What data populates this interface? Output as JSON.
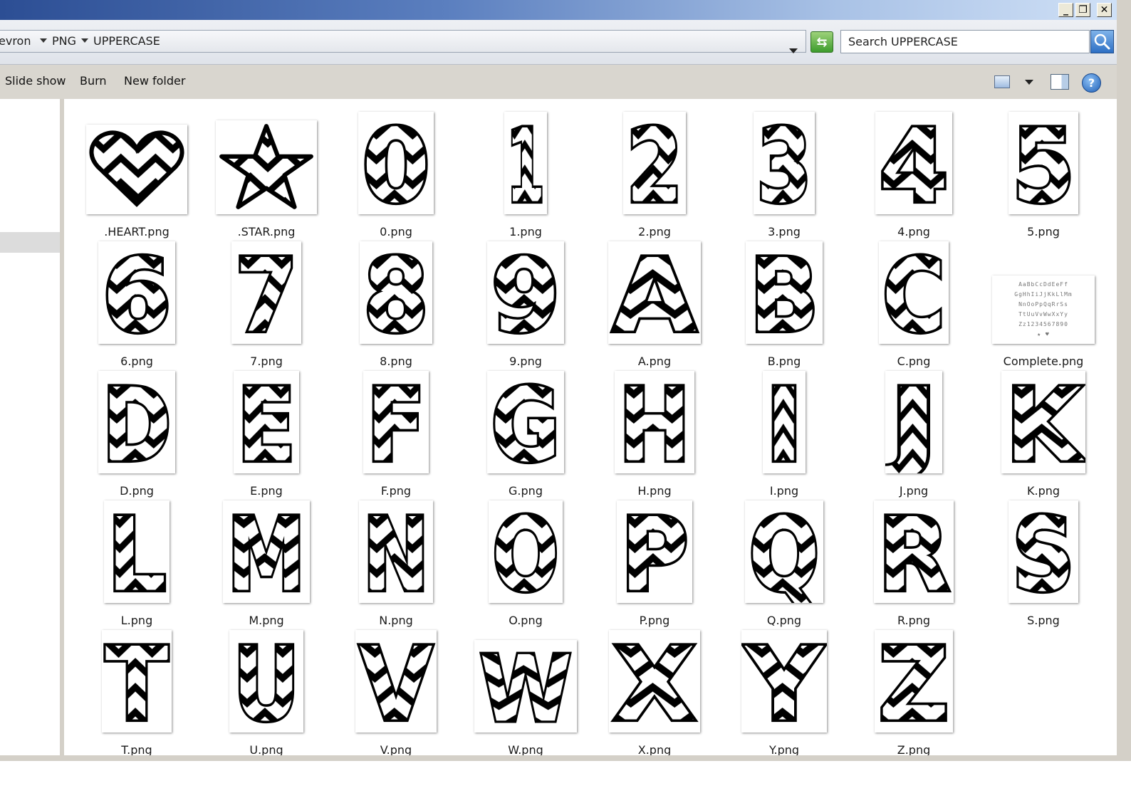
{
  "titlebar": {
    "minimize": "_",
    "restore": "❐",
    "close": "✕"
  },
  "address": {
    "crumbs": [
      "evron",
      "PNG",
      "UPPERCASE"
    ],
    "search_value": "Search UPPERCASE"
  },
  "toolbar": {
    "slideshow_label": "Slide show",
    "burn_label": "Burn",
    "new_folder_label": "New folder",
    "help_label": "?"
  },
  "files": [
    {
      "name": ".HEART.png",
      "shape": "heart"
    },
    {
      "name": ".STAR.png",
      "shape": "star"
    },
    {
      "name": "0.png",
      "glyph": "0"
    },
    {
      "name": "1.png",
      "glyph": "1"
    },
    {
      "name": "2.png",
      "glyph": "2"
    },
    {
      "name": "3.png",
      "glyph": "3"
    },
    {
      "name": "4.png",
      "glyph": "4"
    },
    {
      "name": "5.png",
      "glyph": "5"
    },
    {
      "name": "6.png",
      "glyph": "6"
    },
    {
      "name": "7.png",
      "glyph": "7"
    },
    {
      "name": "8.png",
      "glyph": "8"
    },
    {
      "name": "9.png",
      "glyph": "9"
    },
    {
      "name": "A.png",
      "glyph": "A"
    },
    {
      "name": "B.png",
      "glyph": "B"
    },
    {
      "name": "C.png",
      "glyph": "C"
    },
    {
      "name": "Complete.png",
      "shape": "complete"
    },
    {
      "name": "D.png",
      "glyph": "D"
    },
    {
      "name": "E.png",
      "glyph": "E"
    },
    {
      "name": "F.png",
      "glyph": "F"
    },
    {
      "name": "G.png",
      "glyph": "G"
    },
    {
      "name": "H.png",
      "glyph": "H"
    },
    {
      "name": "I.png",
      "glyph": "I"
    },
    {
      "name": "J.png",
      "glyph": "J"
    },
    {
      "name": "K.png",
      "glyph": "K"
    },
    {
      "name": "L.png",
      "glyph": "L"
    },
    {
      "name": "M.png",
      "glyph": "M"
    },
    {
      "name": "N.png",
      "glyph": "N"
    },
    {
      "name": "O.png",
      "glyph": "O"
    },
    {
      "name": "P.png",
      "glyph": "P"
    },
    {
      "name": "Q.png",
      "glyph": "Q"
    },
    {
      "name": "R.png",
      "glyph": "R"
    },
    {
      "name": "S.png",
      "glyph": "S"
    },
    {
      "name": "T.png",
      "glyph": "T"
    },
    {
      "name": "U.png",
      "glyph": "U"
    },
    {
      "name": "V.png",
      "glyph": "V"
    },
    {
      "name": "W.png",
      "glyph": "W"
    },
    {
      "name": "X.png",
      "glyph": "X"
    },
    {
      "name": "Y.png",
      "glyph": "Y"
    },
    {
      "name": "Z.png",
      "glyph": "Z"
    }
  ],
  "complete_preview_rows": [
    "AaBbCcDdEeFf",
    "GgHhIiJjKkLlMm",
    "NnOoPpQqRrSs",
    "TtUuVvWwXxYy",
    "Zz1234567890",
    "★ ♥"
  ]
}
